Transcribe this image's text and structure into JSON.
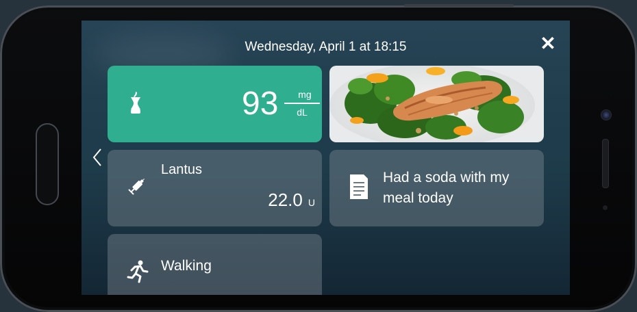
{
  "header": {
    "date_label": "Wednesday, April 1 at 18:15"
  },
  "glucose": {
    "value": "93",
    "unit_numerator": "mg",
    "unit_denominator": "dL",
    "icon": "apple-core-icon",
    "accent_color": "#2faf90"
  },
  "meal_photo": {
    "icon": "meal-photo"
  },
  "insulin": {
    "name": "Lantus",
    "dose": "22.0",
    "unit": "U",
    "icon": "syringe-icon"
  },
  "note": {
    "text": "Had a soda with my meal today",
    "icon": "note-icon"
  },
  "activity": {
    "name": "Walking",
    "icon": "running-person-icon"
  },
  "controls": {
    "close": "✕",
    "back": "back-chevron-icon"
  }
}
